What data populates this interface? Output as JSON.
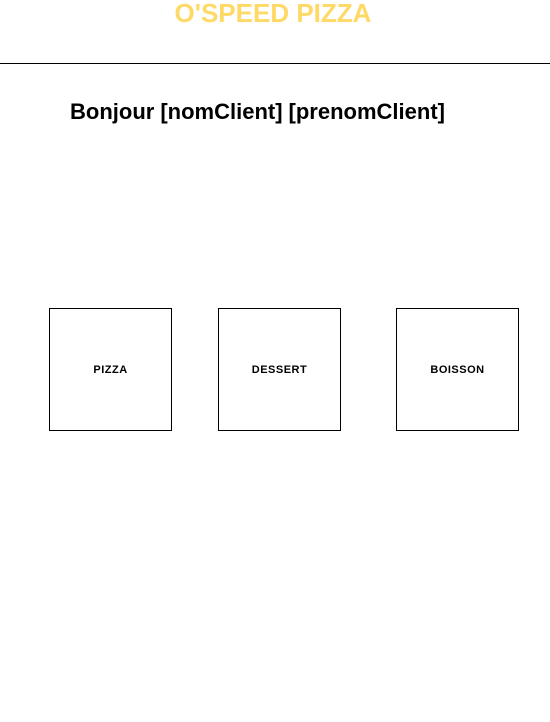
{
  "header": {
    "brand": "O'SPEED PIZZA",
    "brand_color": "#ffd966"
  },
  "greeting": {
    "prefix": "Bonjour",
    "last_name_placeholder": "[nomClient]",
    "first_name_placeholder": "[prenomClient]"
  },
  "categories": [
    {
      "label": "PIZZA"
    },
    {
      "label": "DESSERT"
    },
    {
      "label": "BOISSON"
    }
  ]
}
